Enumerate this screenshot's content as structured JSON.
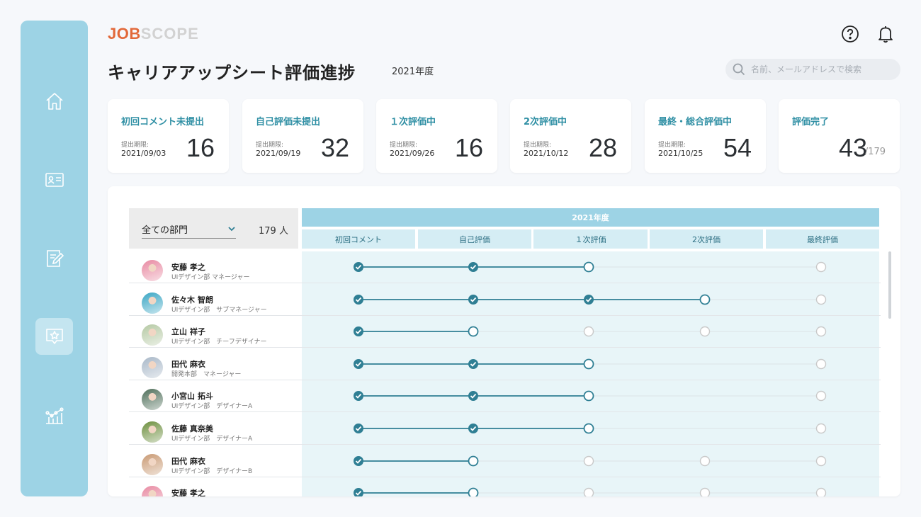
{
  "colors": {
    "accent": "#2f7f94",
    "sidebar": "#9dd3e5",
    "band": "#9dd3e5",
    "stage_head": "#d5edf4",
    "timeline_bg": "#e8f5f8",
    "logo_job": "#e2693a",
    "logo_scope": "#d2d2d2"
  },
  "logo": {
    "part1": "JOB",
    "part2": "SCOPE"
  },
  "header": {
    "title": "キャリアアップシート評価進捗",
    "year": "2021年度",
    "search_placeholder": "名前、メールアドレスで検索",
    "help_icon": "help-circle-icon",
    "bell_icon": "bell-icon"
  },
  "sidebar": {
    "items": [
      {
        "icon": "home-icon",
        "active": false
      },
      {
        "icon": "id-card-icon",
        "active": false
      },
      {
        "icon": "edit-sheet-icon",
        "active": false
      },
      {
        "icon": "star-badge-icon",
        "active": true
      },
      {
        "icon": "chart-icon",
        "active": false
      }
    ]
  },
  "cards": [
    {
      "title": "初回コメント未提出",
      "due_label": "提出期限:",
      "due": "2021/09/03",
      "count": "16"
    },
    {
      "title": "自己評価未提出",
      "due_label": "提出期限:",
      "due": "2021/09/19",
      "count": "32"
    },
    {
      "title": "１次評価中",
      "due_label": "提出期限:",
      "due": "2021/09/26",
      "count": "16"
    },
    {
      "title": "2次評価中",
      "due_label": "提出期限:",
      "due": "2021/10/12",
      "count": "28"
    },
    {
      "title": "最終・総合評価中",
      "due_label": "提出期限:",
      "due": "2021/10/25",
      "count": "54"
    },
    {
      "title": "評価完了",
      "count": "43",
      "total": "/179"
    }
  ],
  "filter": {
    "department": "全ての部門",
    "member_count": "179 人"
  },
  "table": {
    "year_band": "2021年度",
    "stages": [
      "初回コメント",
      "自己評価",
      "１次評価",
      "2次評価",
      "最終評価"
    ],
    "rows": [
      {
        "name": "安藤 孝之",
        "dept": "UIデザイン部 マネージャー",
        "stages": [
          "done",
          "done",
          "current",
          "none",
          "pending"
        ],
        "avatar": "#e88aa2"
      },
      {
        "name": "佐々木 智朗",
        "dept": "UIデザイン部　サブマネージャー",
        "stages": [
          "done",
          "done",
          "done",
          "current",
          "pending"
        ],
        "avatar": "#3aa6c4"
      },
      {
        "name": "立山 祥子",
        "dept": "UIデザイン部　チーフデザイナー",
        "stages": [
          "done",
          "current",
          "pending",
          "pending",
          "pending"
        ],
        "avatar": "#b5c9a4"
      },
      {
        "name": "田代 麻衣",
        "dept": "開発本部　マネージャー",
        "stages": [
          "done",
          "done",
          "current",
          "none",
          "pending"
        ],
        "avatar": "#a9b8c8"
      },
      {
        "name": "小宮山 拓斗",
        "dept": "UIデザイン部　デザイナーA",
        "stages": [
          "done",
          "done",
          "current",
          "none",
          "pending"
        ],
        "avatar": "#4f6f5a"
      },
      {
        "name": "佐藤 真奈美",
        "dept": "UIデザイン部　デザイナーA",
        "stages": [
          "done",
          "done",
          "current",
          "none",
          "pending"
        ],
        "avatar": "#6d8f3e"
      },
      {
        "name": "田代 麻衣",
        "dept": "UIデザイン部　デザイナーB",
        "stages": [
          "done",
          "current",
          "pending",
          "pending",
          "pending"
        ],
        "avatar": "#c99a74"
      },
      {
        "name": "安藤 孝之",
        "dept": "",
        "stages": [
          "done",
          "current",
          "pending",
          "pending",
          "pending"
        ],
        "avatar": "#e88aa2"
      }
    ]
  }
}
